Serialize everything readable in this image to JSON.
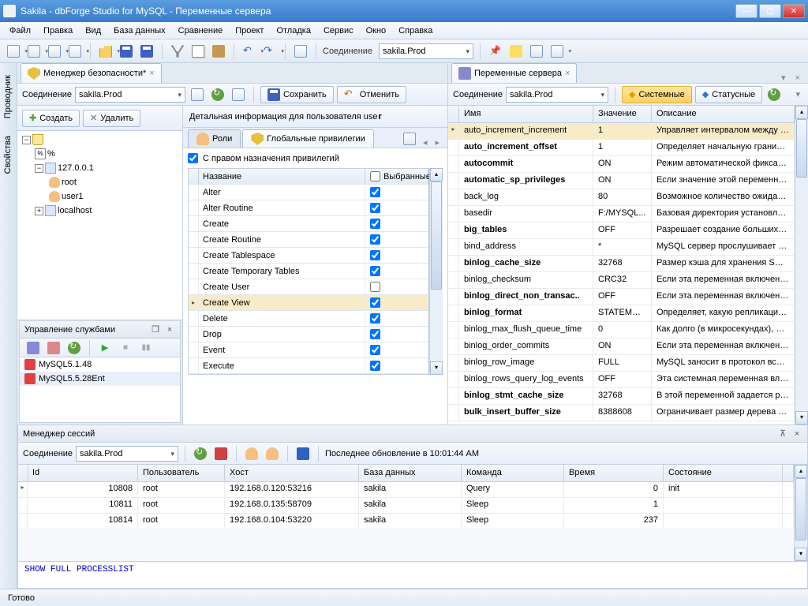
{
  "window": {
    "title": "Sakila - dbForge Studio for MySQL - Переменные сервера"
  },
  "menu": [
    "Файл",
    "Правка",
    "Вид",
    "База данных",
    "Сравнение",
    "Проект",
    "Отладка",
    "Сервис",
    "Окно",
    "Справка"
  ],
  "toolbar": {
    "conn_label": "Соединение",
    "conn_value": "sakila.Prod"
  },
  "vtabs": [
    "Проводник",
    "Свойства"
  ],
  "doc_tabs": {
    "left": "Менеджер безопасности*",
    "right": "Переменные сервера"
  },
  "security": {
    "conn_label": "Соединение",
    "conn_value": "sakila.Prod",
    "save": "Сохранить",
    "cancel": "Отменить",
    "create": "Создать",
    "delete": "Удалить",
    "tree": {
      "root1": "%",
      "root2": "127.0.0.1",
      "u1": "root",
      "u2": "user1",
      "root3": "localhost"
    },
    "details_title": "Детальная информация для пользователя use",
    "tab_roles": "Роли",
    "tab_global": "Глобальные привилегии",
    "grant_label": "С правом назначения привилегий",
    "col_name": "Название",
    "col_sel": "Выбранные",
    "privs": [
      "Alter",
      "Alter Routine",
      "Create",
      "Create Routine",
      "Create Tablespace",
      "Create Temporary Tables",
      "Create User",
      "Create View",
      "Delete",
      "Drop",
      "Event",
      "Execute"
    ],
    "checks": [
      true,
      true,
      true,
      true,
      true,
      true,
      false,
      true,
      true,
      true,
      true,
      true
    ],
    "selected_row": 7
  },
  "services": {
    "title": "Управление службами",
    "items": [
      "MySQL5.1.48",
      "MySQL5.5.28Ent"
    ],
    "selected": 1
  },
  "vars": {
    "conn_label": "Соединение",
    "conn_value": "sakila.Prod",
    "btn_system": "Системные",
    "btn_status": "Статусные",
    "col_name": "Имя",
    "col_value": "Значение",
    "col_desc": "Описание",
    "rows": [
      {
        "n": "auto_increment_increment",
        "v": "1",
        "d": "Управляет интервалом между доп...",
        "b": false,
        "sel": true
      },
      {
        "n": "auto_increment_offset",
        "v": "1",
        "d": "Определяет начальную границу з...",
        "b": true
      },
      {
        "n": "autocommit",
        "v": "ON",
        "d": "Режим автоматической фиксации...",
        "b": true
      },
      {
        "n": "automatic_sp_privileges",
        "v": "ON",
        "d": "Если значение этой переменной р...",
        "b": true
      },
      {
        "n": "back_log",
        "v": "80",
        "d": "Возможное количество ожидающ...",
        "b": false
      },
      {
        "n": "basedir",
        "v": "F:/MYSQL...",
        "d": "Базовая директория установленн...",
        "b": false
      },
      {
        "n": "big_tables",
        "v": "OFF",
        "d": "Разрешает создание больших рез...",
        "b": true
      },
      {
        "n": "bind_address",
        "v": "*",
        "d": "MySQL сервер прослушивает TCP/...",
        "b": false
      },
      {
        "n": "binlog_cache_size",
        "v": "32768",
        "d": "Размер кэша для хранения SQL вы...",
        "b": true
      },
      {
        "n": "binlog_checksum",
        "v": "CRC32",
        "d": "Если эта переменная включена, т...",
        "b": false
      },
      {
        "n": "binlog_direct_non_transac..",
        "v": "OFF",
        "d": "Если эта переменная включена, о...",
        "b": true
      },
      {
        "n": "binlog_format",
        "v": "STATEMENT",
        "d": "Определяет, какую репликацию ...",
        "b": true
      },
      {
        "n": "binlog_max_flush_queue_time",
        "v": "0",
        "d": "Как долго (в микросекундах), про...",
        "b": false
      },
      {
        "n": "binlog_order_commits",
        "v": "ON",
        "d": "Если эта переменная включена (з...",
        "b": false
      },
      {
        "n": "binlog_row_image",
        "v": "FULL",
        "d": "MySQL заносит в протокол все стр...",
        "b": false
      },
      {
        "n": "binlog_rows_query_log_events",
        "v": "OFF",
        "d": "Эта системная переменная влияет...",
        "b": false
      },
      {
        "n": "binlog_stmt_cache_size",
        "v": "32768",
        "d": "В этой переменной задается разм...",
        "b": true
      },
      {
        "n": "bulk_insert_buffer_size",
        "v": "8388608",
        "d": "Ограничивает размер дерева кэш...",
        "b": true
      }
    ]
  },
  "sessions": {
    "title": "Менеджер сессий",
    "conn_label": "Соединение",
    "conn_value": "sakila.Prod",
    "updated_label": "Последнее обновление в 10:01:44 AM",
    "cols": [
      "Id",
      "Пользователь",
      "Хост",
      "База данных",
      "Команда",
      "Время",
      "Состояние"
    ],
    "rows": [
      {
        "id": "10808",
        "user": "root",
        "host": "192.168.0.120:53216",
        "db": "sakila",
        "cmd": "Query",
        "time": "0",
        "state": "init",
        "sel": true
      },
      {
        "id": "10811",
        "user": "root",
        "host": "192.168.0.135:58709",
        "db": "sakila",
        "cmd": "Sleep",
        "time": "1",
        "state": ""
      },
      {
        "id": "10814",
        "user": "root",
        "host": "192.168.0.104:53220",
        "db": "sakila",
        "cmd": "Sleep",
        "time": "237",
        "state": ""
      }
    ],
    "sql": "SHOW FULL PROCESSLIST"
  },
  "status": "Готово"
}
